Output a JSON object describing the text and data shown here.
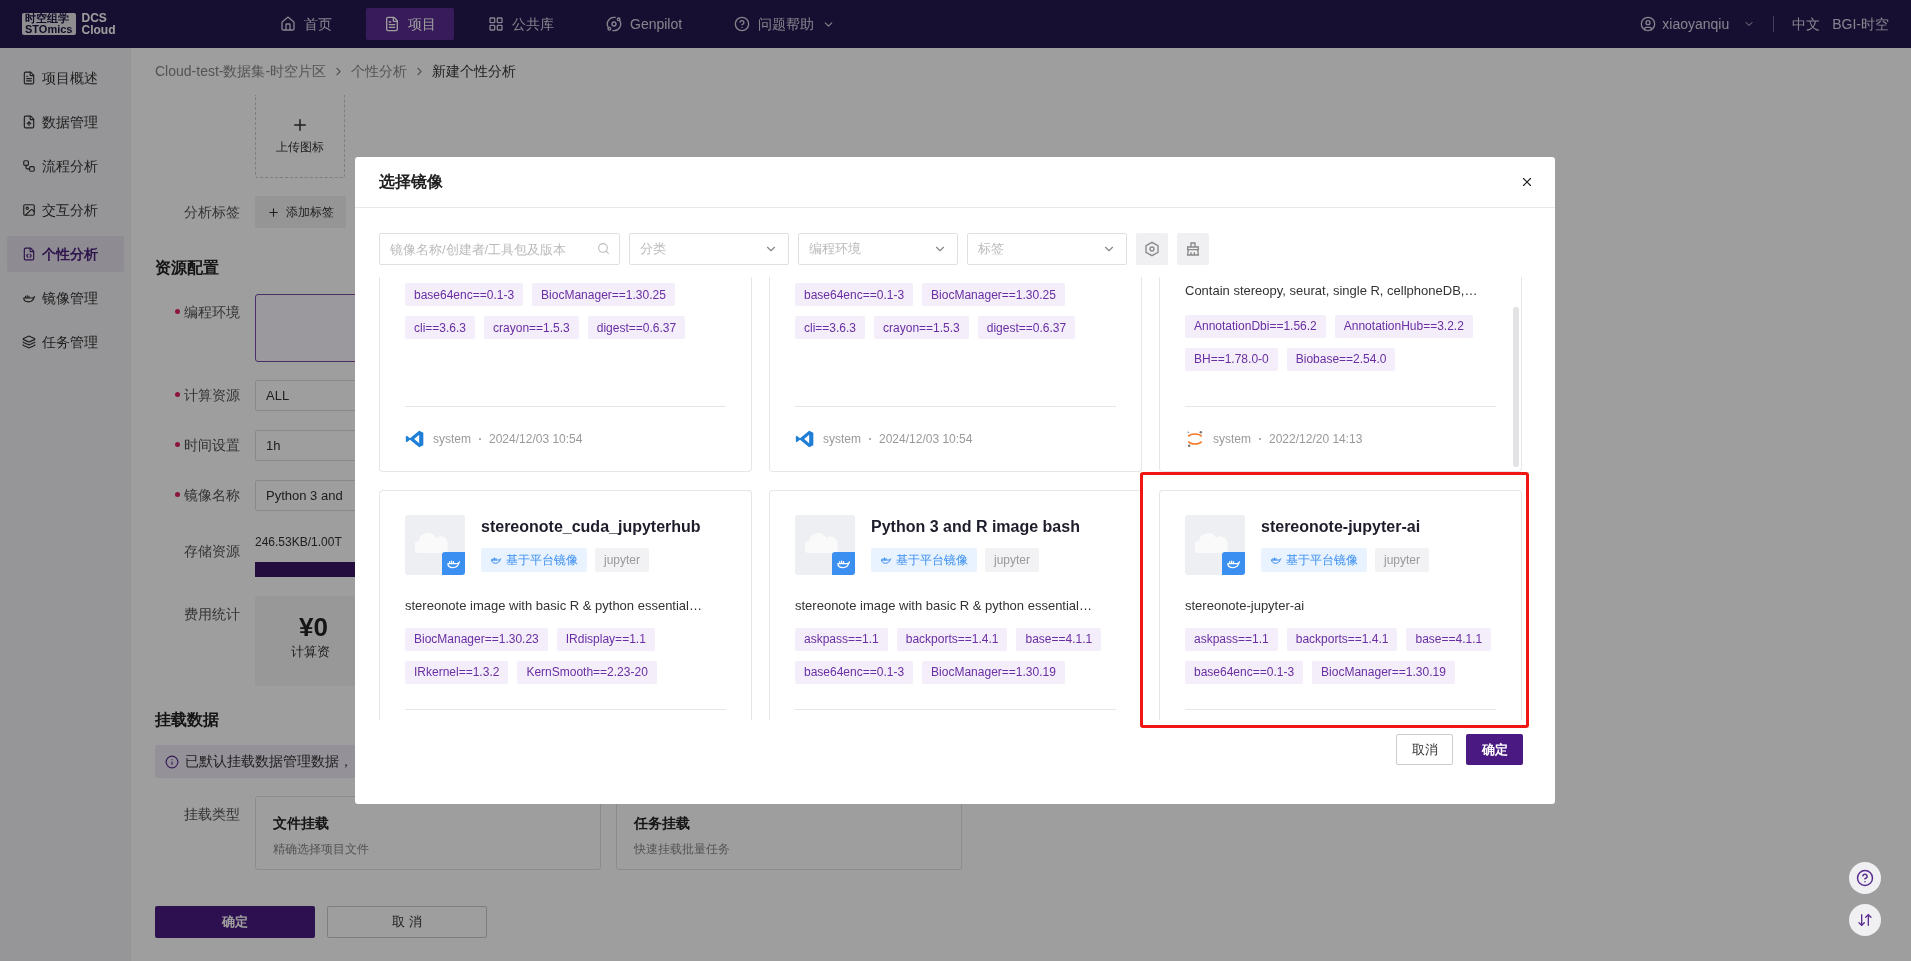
{
  "top_bar": {
    "logo": {
      "line_1": "时空组学",
      "line_2": "STOmics",
      "product_1": "DCS",
      "product_2": "Cloud"
    },
    "nav": [
      {
        "label": "首页",
        "selected": false,
        "has_menu": false
      },
      {
        "label": "项目",
        "selected": true,
        "has_menu": false
      },
      {
        "label": "公共库",
        "selected": false,
        "has_menu": false
      },
      {
        "label": "Genpilot",
        "selected": false,
        "has_menu": false
      },
      {
        "label": "问题帮助",
        "selected": false,
        "has_menu": true
      }
    ],
    "user": "xiaoyanqiu",
    "language": "中文",
    "org": "BGI-时空"
  },
  "sidebar": {
    "items": [
      {
        "label": "项目概述",
        "selected": false
      },
      {
        "label": "数据管理",
        "selected": false
      },
      {
        "label": "流程分析",
        "selected": false
      },
      {
        "label": "交互分析",
        "selected": false
      },
      {
        "label": "个性分析",
        "selected": true
      },
      {
        "label": "镜像管理",
        "selected": false
      },
      {
        "label": "任务管理",
        "selected": false
      }
    ]
  },
  "breadcrumb": [
    "Cloud-test-数据集-时空片区",
    "个性分析",
    "新建个性分析"
  ],
  "form": {
    "upload_icon": {
      "label": "上传图标"
    },
    "tags": {
      "label": "分析标签",
      "button": "添加标签"
    },
    "resource_heading": "资源配置",
    "fields": [
      {
        "label": "编程环境",
        "required": true,
        "kind": "box"
      },
      {
        "label": "计算资源",
        "required": true,
        "kind": "input",
        "value": "ALL"
      },
      {
        "label": "时间设置",
        "required": true,
        "kind": "input",
        "value": "1h"
      },
      {
        "label": "镜像名称",
        "required": true,
        "kind": "input",
        "value": "Python 3 and"
      }
    ],
    "storage": {
      "label": "存储资源",
      "reading": "246.53KB/1.00T"
    },
    "cost": {
      "label": "费用统计",
      "amount": "¥0",
      "caption": "计算资"
    },
    "mount_heading": "挂载数据",
    "notice": "已默认挂载数据管理数据，",
    "mount_type": {
      "label": "挂载类型",
      "options": [
        {
          "title": "文件挂载",
          "subtitle": "精确选择项目文件"
        },
        {
          "title": "任务挂载",
          "subtitle": "快速挂载批量任务"
        }
      ]
    },
    "actions": {
      "confirm": "确定",
      "cancel": "取 消"
    }
  },
  "modal": {
    "title": "选择镜像",
    "filters": {
      "search_placeholder": "镜像名称/创建者/工具包及版本",
      "selects": [
        "分类",
        "编程环境",
        "标签"
      ]
    },
    "cards": [
      {
        "kind": "lower",
        "highlighted": false,
        "tag_rows": [
          [
            "base64enc==0.1-3",
            "BiocManager==1.30.25"
          ],
          [
            "cli==3.6.3",
            "crayon==1.5.3",
            "digest==0.6.37"
          ]
        ],
        "footer": {
          "kind": "ribbon",
          "author": "system",
          "date": "2024/12/03 10:54"
        }
      },
      {
        "kind": "lower",
        "highlighted": false,
        "tag_rows": [
          [
            "base64enc==0.1-3",
            "BiocManager==1.30.25"
          ],
          [
            "cli==3.6.3",
            "crayon==1.5.3",
            "digest==0.6.37"
          ]
        ],
        "footer": {
          "kind": "ribbon",
          "author": "system",
          "date": "2024/12/03 10:54"
        }
      },
      {
        "kind": "lower",
        "highlighted": false,
        "description": "Contain stereopy, seurat, single R, cellphoneDB,…",
        "tag_rows": [
          [
            "AnnotationDbi==1.56.2",
            "AnnotationHub==3.2.2"
          ],
          [
            "BH==1.78.0-0",
            "Biobase==2.54.0"
          ]
        ],
        "footer": {
          "kind": "orbit",
          "author": "system",
          "date": "2022/12/20 14:13"
        }
      },
      {
        "kind": "upper",
        "highlighted": false,
        "title": "stereonote_cuda_jupyterhub",
        "badges": [
          {
            "kind": "platform",
            "label": "基于平台镜像"
          },
          {
            "kind": "plain",
            "label": "jupyter"
          }
        ],
        "description": "stereonote image with basic R & python essential…",
        "tag_rows": [
          [
            "BiocManager==1.30.23",
            "IRdisplay==1.1"
          ],
          [
            "IRkernel==1.3.2",
            "KernSmooth==2.23-20"
          ]
        ]
      },
      {
        "kind": "upper",
        "highlighted": false,
        "title": "Python 3 and R image bash",
        "badges": [
          {
            "kind": "platform",
            "label": "基于平台镜像"
          },
          {
            "kind": "plain",
            "label": "jupyter"
          }
        ],
        "description": "stereonote image with basic R & python essential…",
        "tag_rows": [
          [
            "askpass==1.1",
            "backports==1.4.1",
            "base==4.1.1"
          ],
          [
            "base64enc==0.1-3",
            "BiocManager==1.30.19"
          ]
        ]
      },
      {
        "kind": "upper",
        "highlighted": true,
        "title": "stereonote-jupyter-ai",
        "badges": [
          {
            "kind": "platform",
            "label": "基于平台镜像"
          },
          {
            "kind": "plain",
            "label": "jupyter"
          }
        ],
        "description": "stereonote-jupyter-ai",
        "tag_rows": [
          [
            "askpass==1.1",
            "backports==1.4.1",
            "base==4.1.1"
          ],
          [
            "base64enc==0.1-3",
            "BiocManager==1.30.19"
          ]
        ]
      }
    ],
    "cancel": "取消",
    "confirm": "确定"
  }
}
